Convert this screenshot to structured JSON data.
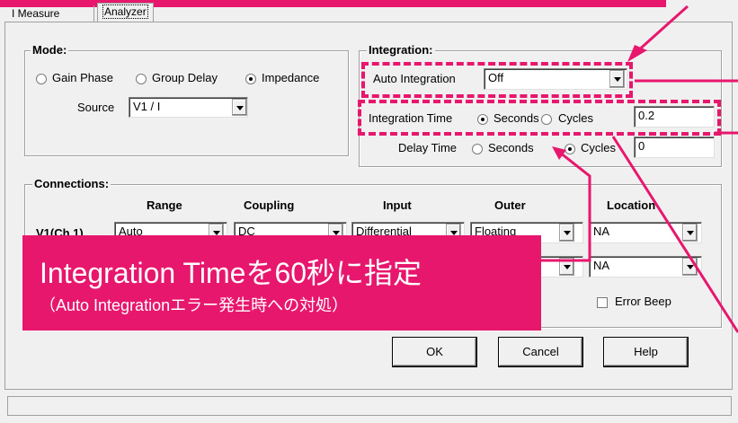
{
  "tabs": [
    "I Measure",
    "Analyzer"
  ],
  "mode": {
    "title": "Mode:",
    "options": [
      "Gain Phase",
      "Group Delay",
      "Impedance"
    ],
    "selected": "Impedance",
    "source_label": "Source",
    "source_value": "V1 / I"
  },
  "integration": {
    "title": "Integration:",
    "auto_label": "Auto Integration",
    "auto_value": "Off",
    "time_label": "Integration Time",
    "time_seconds": "Seconds",
    "time_cycles": "Cycles",
    "time_selected": "Seconds",
    "time_value": "0.2",
    "delay_label": "Delay Time",
    "delay_seconds": "Seconds",
    "delay_cycles": "Cycles",
    "delay_selected": "Cycles",
    "delay_value": "0"
  },
  "connections": {
    "title": "Connections:",
    "headers": [
      "Range",
      "Coupling",
      "Input",
      "Outer",
      "Location"
    ],
    "row1": {
      "label": "V1(Ch.1)",
      "range": "Auto",
      "coupling": "DC",
      "input": "Differential",
      "outer": "Floating",
      "location": "NA"
    },
    "row2": {
      "location": "NA"
    },
    "error_beep": "Error Beep"
  },
  "buttons": {
    "ok": "OK",
    "cancel": "Cancel",
    "help": "Help"
  },
  "callout": {
    "line1": "Integration Timeを60秒に指定",
    "line2": "（Auto Integrationエラー発生時への対処）"
  },
  "colors": {
    "accent": "#e8176e",
    "window_bg": "#f0f0f0"
  }
}
